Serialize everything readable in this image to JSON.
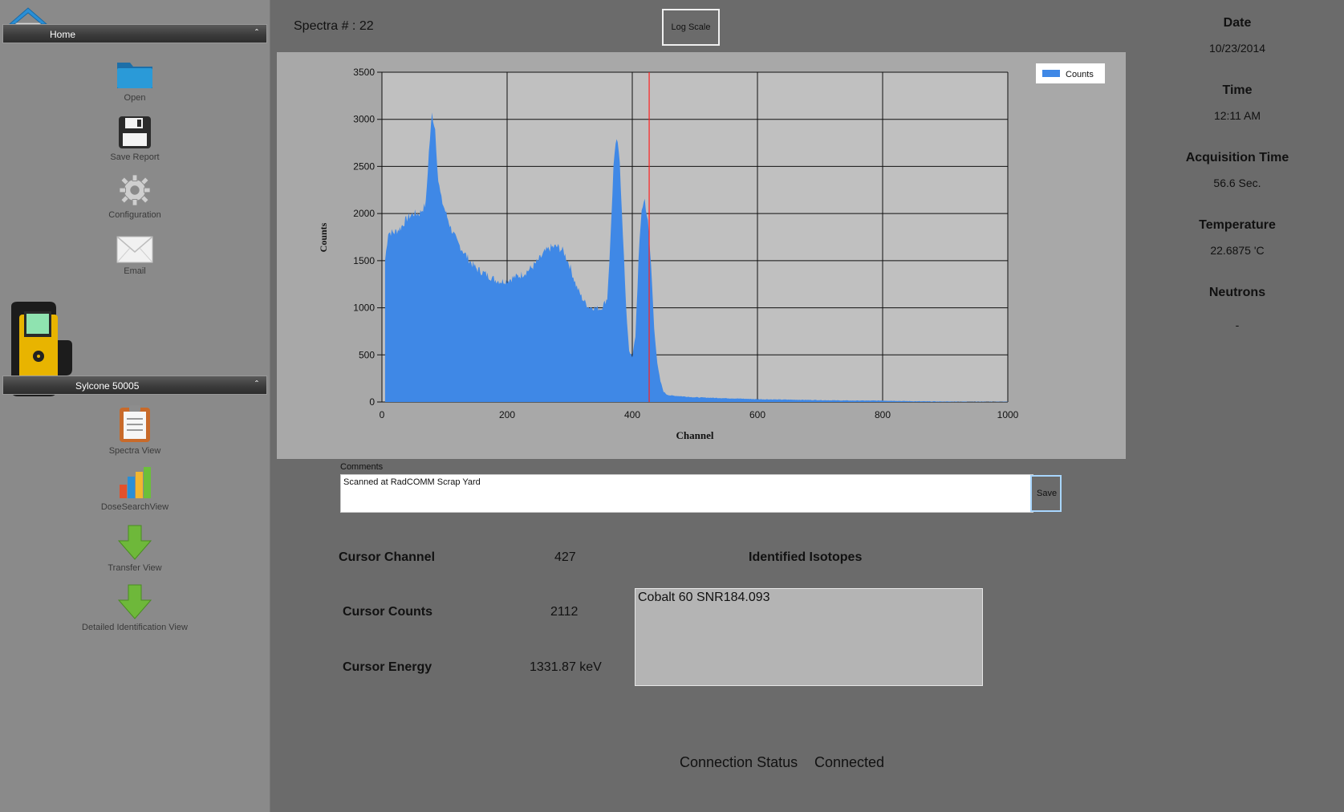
{
  "sidebar": {
    "home_section": {
      "label": "Home"
    },
    "home_items": [
      {
        "label": "Open",
        "icon": "folder-icon"
      },
      {
        "label": "Save Report",
        "icon": "floppy-icon"
      },
      {
        "label": "Configuration",
        "icon": "gear-icon"
      },
      {
        "label": "Email",
        "icon": "envelope-icon"
      }
    ],
    "device_section": {
      "label": "Sylcone 50005"
    },
    "device_items": [
      {
        "label": "Spectra View",
        "icon": "clipboard-icon"
      },
      {
        "label": "DoseSearchView",
        "icon": "bar-chart-icon"
      },
      {
        "label": "Transfer View",
        "icon": "down-arrow-icon"
      },
      {
        "label": "Detailed Identification View",
        "icon": "down-arrow-icon"
      }
    ]
  },
  "header": {
    "spectra_label": "Spectra # : 22",
    "log_scale_button": "Log Scale"
  },
  "chart_data": {
    "type": "area",
    "xlabel": "Channel",
    "ylabel": "Counts",
    "xlim": [
      0,
      1000
    ],
    "ylim": [
      0,
      3500
    ],
    "x_ticks": [
      "0",
      "200",
      "400",
      "600",
      "800",
      "1000"
    ],
    "y_ticks": [
      "0",
      "500",
      "1000",
      "1500",
      "2000",
      "2500",
      "3000",
      "3500"
    ],
    "legend": "Counts",
    "legend_position": "top-right",
    "grid": true,
    "cursor_x": 427,
    "series_color": "#3f88e6",
    "cursor_color": "#ff2020",
    "series": [
      {
        "name": "Counts",
        "x": [
          5,
          10,
          20,
          30,
          40,
          50,
          60,
          70,
          75,
          80,
          85,
          90,
          95,
          100,
          110,
          120,
          130,
          140,
          150,
          160,
          170,
          180,
          190,
          200,
          210,
          220,
          230,
          240,
          250,
          260,
          270,
          280,
          290,
          300,
          310,
          320,
          330,
          340,
          350,
          360,
          365,
          370,
          375,
          380,
          385,
          390,
          395,
          400,
          405,
          410,
          415,
          420,
          425,
          430,
          435,
          440,
          445,
          450,
          455,
          460,
          470,
          480,
          500,
          550,
          600,
          650,
          700,
          750,
          800,
          850,
          900,
          950,
          1000
        ],
        "y": [
          1500,
          1800,
          1800,
          1850,
          1950,
          2000,
          2000,
          2100,
          2650,
          3060,
          2900,
          2350,
          2150,
          2050,
          1850,
          1700,
          1600,
          1500,
          1420,
          1380,
          1340,
          1300,
          1280,
          1290,
          1320,
          1340,
          1380,
          1430,
          1500,
          1590,
          1640,
          1650,
          1600,
          1450,
          1240,
          1100,
          1010,
          1000,
          990,
          1100,
          1700,
          2500,
          2800,
          2550,
          1800,
          1000,
          550,
          470,
          700,
          1500,
          2050,
          2150,
          1900,
          1450,
          800,
          400,
          220,
          110,
          80,
          70,
          65,
          60,
          50,
          40,
          30,
          25,
          20,
          15,
          15,
          8,
          5,
          3,
          2
        ]
      }
    ]
  },
  "comments": {
    "label": "Comments",
    "value": "Scanned at RadCOMM Scrap Yard",
    "save_button": "Save"
  },
  "cursor": {
    "channel_label": "Cursor Channel",
    "channel_value": "427",
    "counts_label": "Cursor Counts",
    "counts_value": "2112",
    "energy_label": "Cursor Energy",
    "energy_value": "1331.87 keV"
  },
  "isotopes": {
    "label": "Identified Isotopes",
    "items": [
      "Cobalt 60 SNR184.093"
    ]
  },
  "info": {
    "date_label": "Date",
    "date_value": "10/23/2014",
    "time_label": "Time",
    "time_value": "12:11 AM",
    "acq_label": "Acquisition Time",
    "acq_value": "56.6 Sec.",
    "temp_label": "Temperature",
    "temp_value": "22.6875 'C",
    "neutrons_label": "Neutrons",
    "neutrons_value": "-"
  },
  "status": {
    "label": "Connection Status",
    "value": "Connected"
  }
}
